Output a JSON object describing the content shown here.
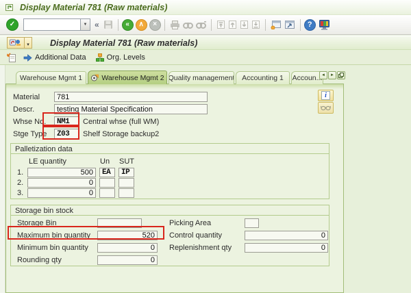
{
  "colors": {
    "accent_green": "#3fae2a",
    "annotation_red": "#d9261c",
    "titlebar_text_green": "#4a6b1d",
    "active_tab_green": "#b4cf82",
    "pane_background": "#ecf3e0"
  },
  "window": {
    "title": "Display Material 781 (Raw materials)"
  },
  "toolbar": {
    "command_value": "",
    "enter_glyph": "✓",
    "dropdown_glyph": "▼",
    "collapse_glyph": "«",
    "back_glyph": "«",
    "exit_glyph": "∧",
    "cancel_glyph": "×",
    "help_glyph": "?"
  },
  "transaction": {
    "title": "Display Material 781 (Raw materials)",
    "gos_dropdown_glyph": "▾",
    "additional_data_label": "Additional Data",
    "org_levels_label": "Org. Levels"
  },
  "tabstrip": {
    "tabs": [
      {
        "label": "Warehouse Mgmt 1"
      },
      {
        "label": "Warehouse Mgmt 2"
      },
      {
        "label": "Quality management"
      },
      {
        "label": "Accounting 1"
      },
      {
        "label": "Accoun..."
      }
    ],
    "scroll_left_glyph": "◄",
    "scroll_right_glyph": "►"
  },
  "header_fields": {
    "material_label": "Material",
    "material_value": "781",
    "descr_label": "Descr.",
    "descr_value": "testing Material Specification",
    "whse_label": "Whse No.",
    "whse_value": "NM1",
    "whse_desc": "Central whse (full WM)",
    "stge_label": "Stge Type",
    "stge_value": "Z03",
    "stge_desc": "Shelf Storage backup2",
    "info_glyph": "i"
  },
  "palletization": {
    "title": "Palletization data",
    "col_le": "LE quantity",
    "col_un": "Un",
    "col_sut": "SUT",
    "rows": [
      {
        "num": "1.",
        "qty": "500",
        "un": "EA",
        "sut": "IP"
      },
      {
        "num": "2.",
        "qty": "0",
        "un": "",
        "sut": ""
      },
      {
        "num": "3.",
        "qty": "0",
        "un": "",
        "sut": ""
      }
    ]
  },
  "storage_bin_stock": {
    "title": "Storage bin stock",
    "storage_bin_label": "Storage Bin",
    "storage_bin_value": "",
    "picking_area_label": "Picking Area",
    "picking_area_value": "",
    "max_bin_label": "Maximum bin quantity",
    "max_bin_value": "520",
    "control_label": "Control quantity",
    "control_value": "0",
    "min_bin_label": "Minimum bin quantity",
    "min_bin_value": "0",
    "replenish_label": "Replenishment qty",
    "replenish_value": "0",
    "rounding_label": "Rounding qty",
    "rounding_value": "0"
  }
}
